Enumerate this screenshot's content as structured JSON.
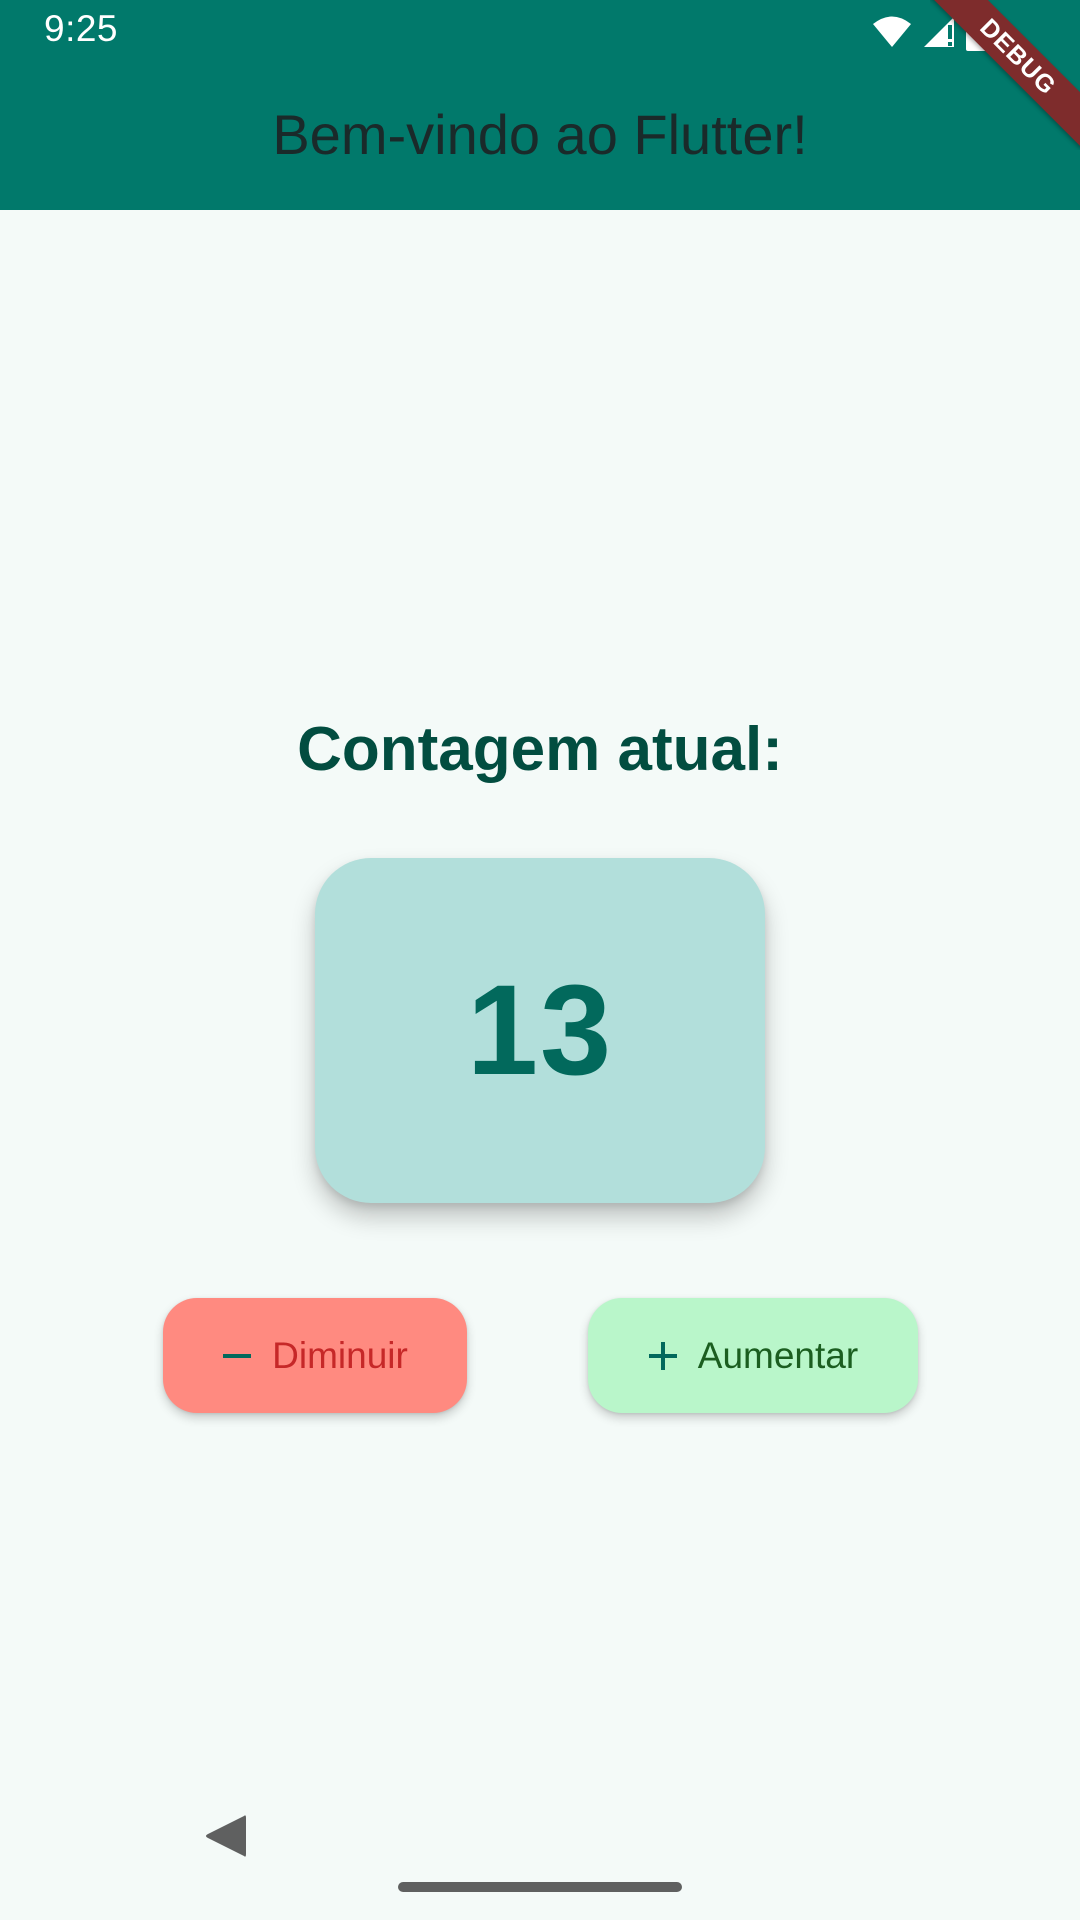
{
  "status_bar": {
    "time": "9:25",
    "icons": [
      "wifi-icon",
      "signal-icon",
      "battery-icon"
    ]
  },
  "app_bar": {
    "title": "Bem-vindo ao Flutter!",
    "background": "#01796b"
  },
  "debug_banner": {
    "label": "DEBUG",
    "color": "#7e2c2c"
  },
  "counter": {
    "heading": "Contagem atual:",
    "value": "13",
    "card_color": "#b2dfdb"
  },
  "buttons": {
    "decrease": {
      "label": "Diminuir",
      "icon": "minus-icon",
      "background": "#ff8a80",
      "text_color": "#c62828"
    },
    "increase": {
      "label": "Aumentar",
      "icon": "plus-icon",
      "background": "#b9f6ca",
      "text_color": "#1b5e20"
    }
  },
  "nav_bar": {
    "items": [
      "back-icon",
      "home-handle"
    ]
  }
}
